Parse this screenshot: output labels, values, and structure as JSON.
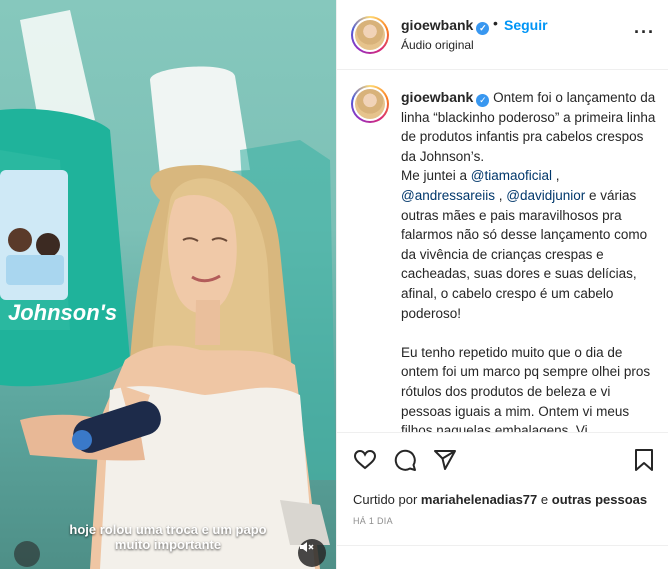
{
  "video": {
    "caption_lines": [
      "hoje rolou uma troca e um papo",
      "muito importante"
    ],
    "mute_icon": "speaker-muted-icon"
  },
  "post_header": {
    "username": "gioewbank",
    "separator": "•",
    "follow_label": "Seguir",
    "audio_label": "Áudio original",
    "more_icon": "more-options-icon"
  },
  "caption": {
    "username": "gioewbank",
    "paragraph1_a": "Ontem foi o lançamento da linha “blackinho poderoso” a primeira linha de produtos infantis pra cabelos crespos da Johnson’s.",
    "paragraph1_b_prefix": "Me juntei a ",
    "mention1": "@tiamaoficial",
    "sep1": " , ",
    "mention2": "@andressareiis",
    "sep2": " , ",
    "mention3": "@davidjunior",
    "paragraph1_b_suffix": " e várias outras mães e pais maravilhosos pra falarmos não só desse lançamento como da vivência de crianças crespas e cacheadas, suas dores e suas delícias, afinal, o cabelo crespo é um cabelo poderoso!",
    "paragraph2": "Eu tenho repetido muito que o dia de ontem foi um marco pq sempre olhei pros rótulos dos produtos de beleza e vi pessoas iguais a mim. Ontem vi meus filhos naquelas embalagens. Vi"
  },
  "actions": {
    "icons": [
      "heart-icon",
      "comment-icon",
      "share-icon",
      "bookmark-icon"
    ]
  },
  "likes": {
    "prefix": "Curtido por ",
    "user": "mariahelenadias77",
    "middle": " e ",
    "others": "outras pessoas"
  },
  "time_ago": "HÁ 1 DIA",
  "colors": {
    "link_blue": "#0095f6",
    "mention": "#00376b",
    "verified_blue": "#3897f0"
  }
}
